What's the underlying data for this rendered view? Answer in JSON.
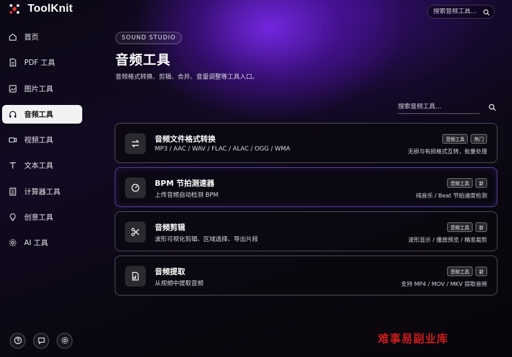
{
  "app": {
    "name": "ToolKnit"
  },
  "top_search": {
    "placeholder": "搜索音频工具..."
  },
  "sidebar": {
    "items": [
      {
        "label": "首页",
        "icon": "home-icon",
        "active": false
      },
      {
        "label": "PDF 工具",
        "icon": "file-icon",
        "active": false
      },
      {
        "label": "图片工具",
        "icon": "image-icon",
        "active": false
      },
      {
        "label": "音频工具",
        "icon": "headphones-icon",
        "active": true
      },
      {
        "label": "视频工具",
        "icon": "video-icon",
        "active": false
      },
      {
        "label": "文本工具",
        "icon": "text-icon",
        "active": false
      },
      {
        "label": "计算器工具",
        "icon": "calculator-icon",
        "active": false
      },
      {
        "label": "创意工具",
        "icon": "lightbulb-icon",
        "active": false
      },
      {
        "label": "AI 工具",
        "icon": "gear-icon",
        "active": false
      }
    ],
    "bottom_icons": [
      "help-icon",
      "chat-icon",
      "settings-icon"
    ]
  },
  "header": {
    "eyebrow": "SOUND STUDIO",
    "title": "音频工具",
    "description": "音频格式转换、剪辑、合并、音量调整等工具入口。"
  },
  "search": {
    "placeholder": "搜索音频工具..."
  },
  "cards": [
    {
      "title": "音频文件格式转换",
      "subtitle": "MP3 / AAC / WAV / FLAC / ALAC / OGG / WMA",
      "tags": [
        "音频工具",
        "热门"
      ],
      "meta": "无损与有损格式互转，批量处理",
      "icon": "swap-arrows-icon"
    },
    {
      "title": "BPM 节拍测速器",
      "subtitle": "上传音频自动检测 BPM",
      "tags": [
        "音频工具",
        "新"
      ],
      "meta": "纯音乐 / Beat 节拍速度检测",
      "icon": "gauge-icon"
    },
    {
      "title": "音频剪辑",
      "subtitle": "波形可视化剪辑、区域选择、导出片段",
      "tags": [
        "音频工具",
        "新"
      ],
      "meta": "波形显示 / 播放预览 / 精准裁剪",
      "icon": "scissors-icon"
    },
    {
      "title": "音频提取",
      "subtitle": "从视频中提取音频",
      "tags": [
        "音频工具",
        "新"
      ],
      "meta": "支持 MP4 / MOV / MKV 提取音频",
      "icon": "audio-file-icon"
    }
  ],
  "watermark": "难事易副业库",
  "colors": {
    "accent_purple": "#7a2ff0",
    "active_nav_bg": "#f2f2f4",
    "watermark_red": "#c81d1d"
  }
}
